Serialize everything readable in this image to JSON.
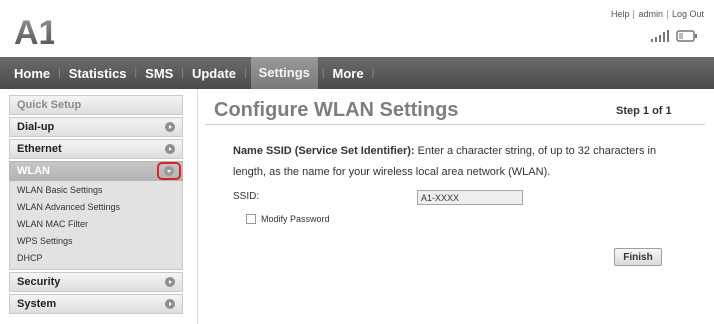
{
  "header": {
    "logo_text": "A1",
    "links": [
      "Help",
      "admin",
      "Log Out"
    ],
    "signal_icon": "signal-bars-icon",
    "battery_icon": "battery-icon"
  },
  "nav": {
    "items": [
      "Home",
      "Statistics",
      "SMS",
      "Update",
      "Settings",
      "More"
    ],
    "active": "Settings"
  },
  "sidebar": {
    "quick_setup": "Quick Setup",
    "dialup": "Dial-up",
    "ethernet": "Ethernet",
    "wlan": "WLAN",
    "wlan_items": [
      "WLAN Basic Settings",
      "WLAN Advanced Settings",
      "WLAN MAC Filter",
      "WPS Settings",
      "DHCP"
    ],
    "security": "Security",
    "system": "System"
  },
  "main": {
    "title": "Configure WLAN Settings",
    "step": "Step 1 of 1",
    "desc_bold": "Name SSID (Service Set Identifier):",
    "desc_text": " Enter a character string, of up to 32 characters in length, as the name for your wireless local area network (WLAN).",
    "ssid_label": "SSID:",
    "ssid_value": "A1-XXXX",
    "modify_password_label": "Modify Password",
    "modify_password_checked": false,
    "finish_label": "Finish"
  },
  "colors": {
    "nav_bg": "#555555",
    "highlight_ring": "#dd2222",
    "title_gray": "#7e7e7e"
  }
}
